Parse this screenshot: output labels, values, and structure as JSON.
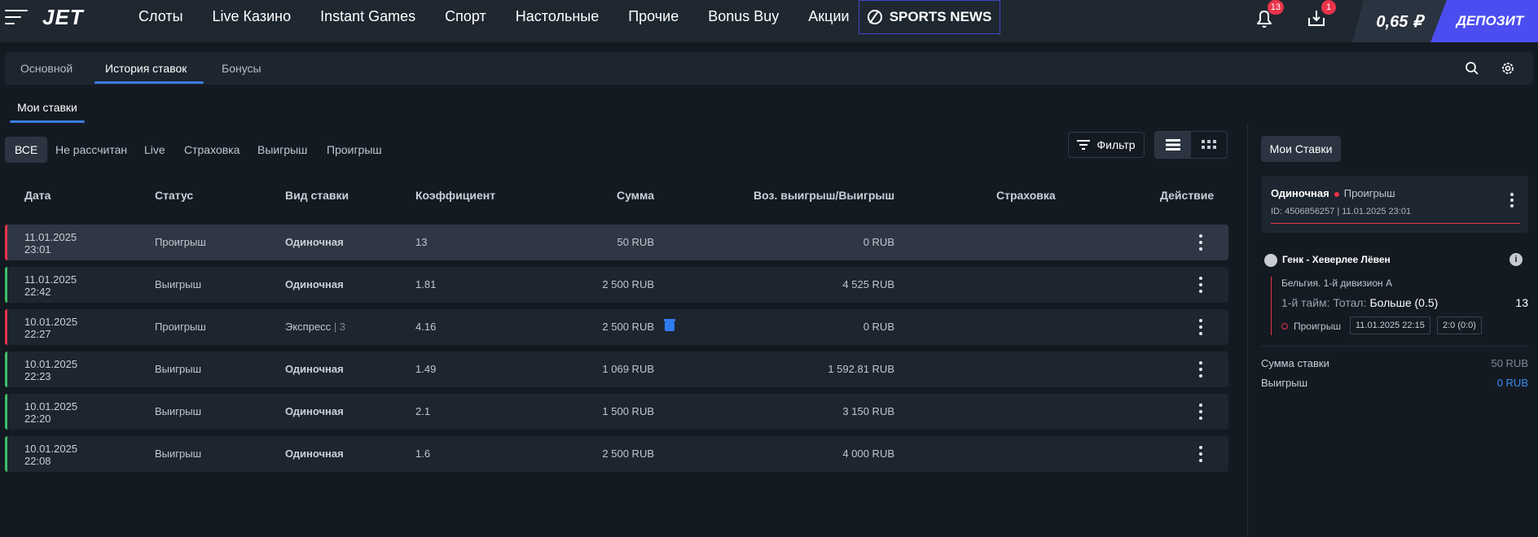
{
  "header": {
    "logo": "JET",
    "nav": [
      "Слоты",
      "Live Казино",
      "Instant Games",
      "Спорт",
      "Настольные",
      "Прочие",
      "Bonus Buy",
      "Акции"
    ],
    "sports_news": "SPORTS NEWS",
    "notifications_badge": "13",
    "messages_badge": "1",
    "balance": "0,65 ₽",
    "deposit": "ДЕПОЗИТ"
  },
  "tabs": [
    "Основной",
    "История ставок",
    "Бонусы"
  ],
  "subtab": "Мои ставки",
  "filters": [
    "ВСЕ",
    "Не рассчитан",
    "Live",
    "Страховка",
    "Выигрыш",
    "Проигрыш"
  ],
  "filter_button": "Фильтр",
  "table": {
    "headers": [
      "Дата",
      "Статус",
      "Вид ставки",
      "Коэффициент",
      "Сумма",
      "Воз. выигрыш/Выигрыш",
      "Страховка",
      "Действие"
    ],
    "rows": [
      {
        "date": "11.01.2025",
        "time": "23:01",
        "status": "Проигрыш",
        "type": "Одиночная",
        "coef": "13",
        "sum": "50 RUB",
        "win": "0 RUB"
      },
      {
        "date": "11.01.2025",
        "time": "22:42",
        "status": "Выигрыш",
        "type": "Одиночная",
        "coef": "1.81",
        "sum": "2 500 RUB",
        "win": "4 525 RUB"
      },
      {
        "date": "10.01.2025",
        "time": "22:27",
        "status": "Проигрыш",
        "type": "Экспресс",
        "type_count": "| 3",
        "coef": "4.16",
        "sum": "2 500 RUB",
        "win": "0 RUB"
      },
      {
        "date": "10.01.2025",
        "time": "22:23",
        "status": "Выигрыш",
        "type": "Одиночная",
        "coef": "1.49",
        "sum": "1 069 RUB",
        "win": "1 592.81 RUB"
      },
      {
        "date": "10.01.2025",
        "time": "22:20",
        "status": "Выигрыш",
        "type": "Одиночная",
        "coef": "2.1",
        "sum": "1 500 RUB",
        "win": "3 150 RUB"
      },
      {
        "date": "10.01.2025",
        "time": "22:08",
        "status": "Выигрыш",
        "type": "Одиночная",
        "coef": "1.6",
        "sum": "2 500 RUB",
        "win": "4 000 RUB"
      }
    ]
  },
  "panel": {
    "button": "Мои Ставки",
    "card_type": "Одиночная",
    "card_status": "Проигрыш",
    "card_id": "ID: 4506856257  |  11.01.2025 23:01",
    "match": "Генк - Хеверлее Лёвен",
    "league": "Бельгия. 1-й дивизион А",
    "market_label": "1-й тайм: Тотал:",
    "market_value": "Больше (0.5)",
    "odds": "13",
    "result": "Проигрыш",
    "match_date": "11.01.2025 22:15",
    "score": "2:0 (0:0)",
    "stake_label": "Сумма ставки",
    "stake_value": "50 RUB",
    "win_label": "Выигрыш",
    "win_value": "0 RUB"
  },
  "colors": {
    "loss_strip": "#e8344a",
    "win_strip": "#3fbf6a",
    "accent": "#3a7de0",
    "deposit": "#4b4df0"
  }
}
